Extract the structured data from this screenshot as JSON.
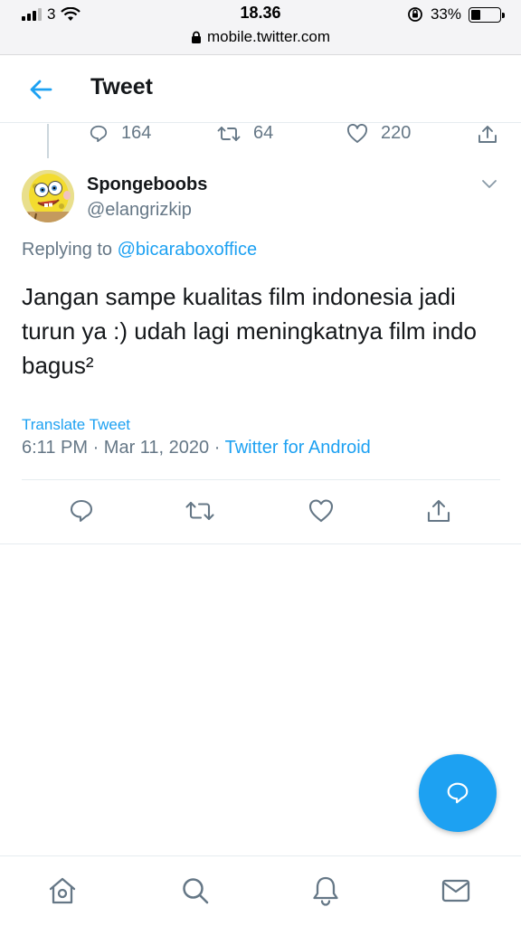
{
  "status_bar": {
    "carrier": "3",
    "time": "18.36",
    "battery_percent": "33%",
    "battery_level": 0.33,
    "url": "mobile.twitter.com"
  },
  "header": {
    "title": "Tweet",
    "back_icon": "arrow-left-icon"
  },
  "previous_tweet_stats": {
    "replies": "164",
    "retweets": "64",
    "likes": "220"
  },
  "tweet": {
    "display_name": "Spongeboobs",
    "handle": "@elangrizkip",
    "replying_prefix": "Replying to",
    "replying_to": "@bicaraboxoffice",
    "text": "Jangan sampe kualitas film indonesia jadi turun ya :) udah lagi meningkatnya film indo bagus²",
    "translate_label": "Translate Tweet",
    "time": "6:11 PM",
    "date": "Mar 11, 2020",
    "separator": "·",
    "source": "Twitter for Android"
  },
  "colors": {
    "accent": "#1da1f2",
    "secondary_text": "#657786",
    "divider": "#e6ecf0"
  },
  "bottom_nav": [
    "home-icon",
    "search-icon",
    "notifications-icon",
    "messages-icon"
  ]
}
